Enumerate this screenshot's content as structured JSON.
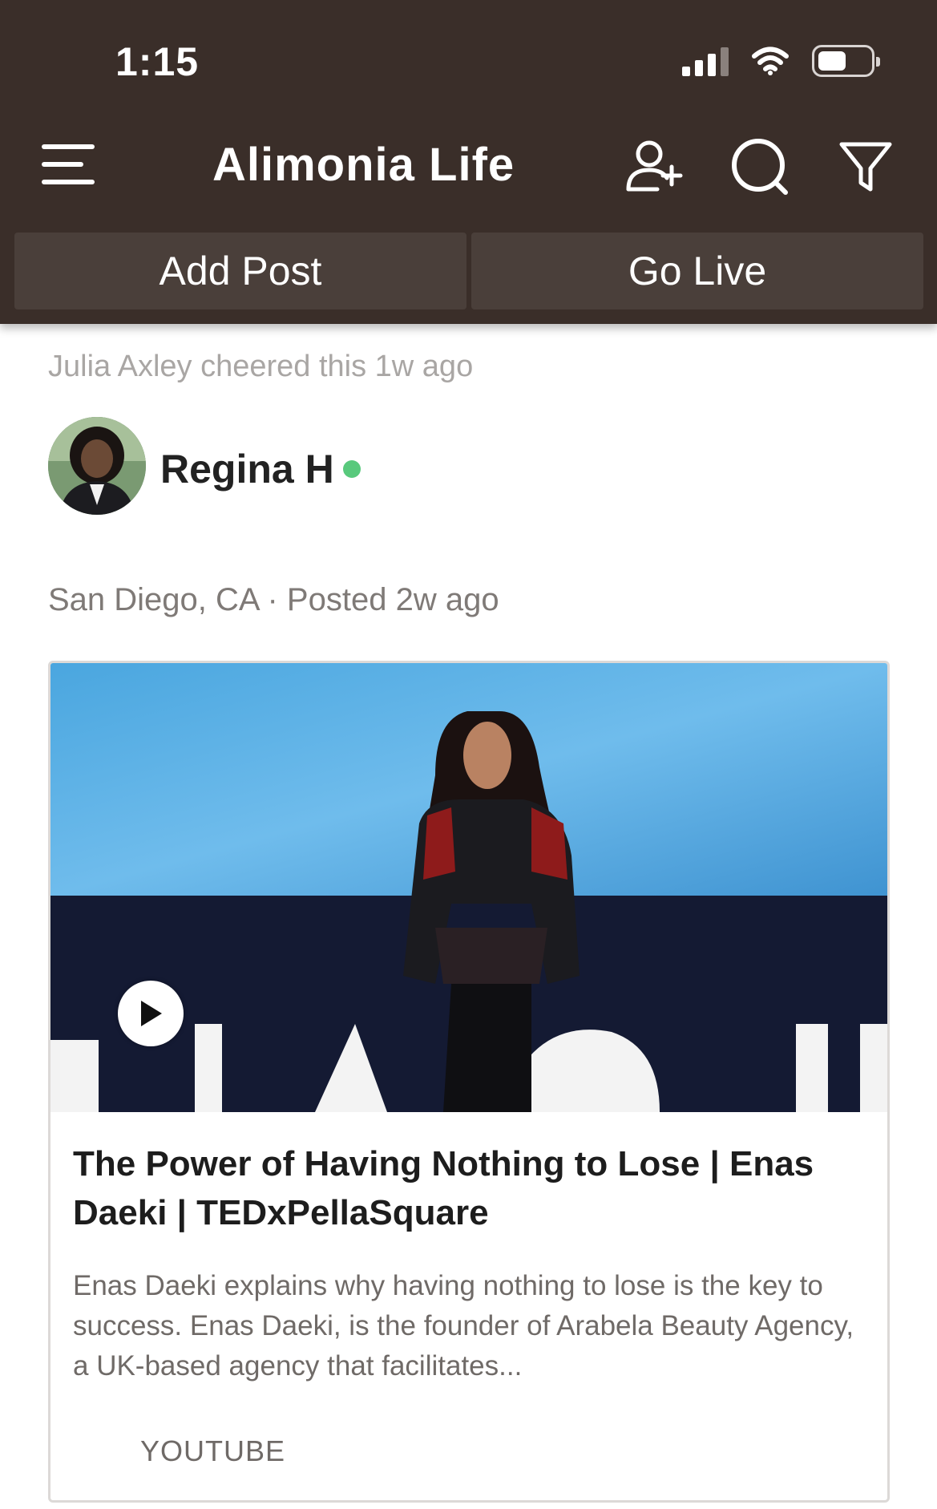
{
  "status_bar": {
    "time": "1:15",
    "icons": [
      "cellular-signal-icon",
      "wifi-icon",
      "battery-icon"
    ]
  },
  "app_bar": {
    "title": "Alimonia Life",
    "menu_icon": "hamburger-menu-icon",
    "actions": [
      "add-friend-icon",
      "search-icon",
      "filter-icon"
    ]
  },
  "actions": {
    "add_post": "Add Post",
    "go_live": "Go Live"
  },
  "feed": {
    "activity": "Julia Axley cheered this 1w ago",
    "post": {
      "author": "Regina H",
      "online": true,
      "meta": "San Diego, CA · Posted 2w ago",
      "link": {
        "title": "The Power of Having Nothing to Lose | Enas Daeki | TEDxPellaSquare",
        "description": "Enas Daeki explains why having nothing to lose is the key to success. Enas Daeki, is the founder of Arabela Beauty Agency, a UK-based agency that facilitates...",
        "source": "YOUTUBE",
        "play_icon": "play-icon"
      }
    }
  },
  "colors": {
    "header_bg": "#3a2e29",
    "button_bg": "#4a3f3a",
    "online": "#58c97c",
    "muted_text": "#a9a6a4"
  }
}
